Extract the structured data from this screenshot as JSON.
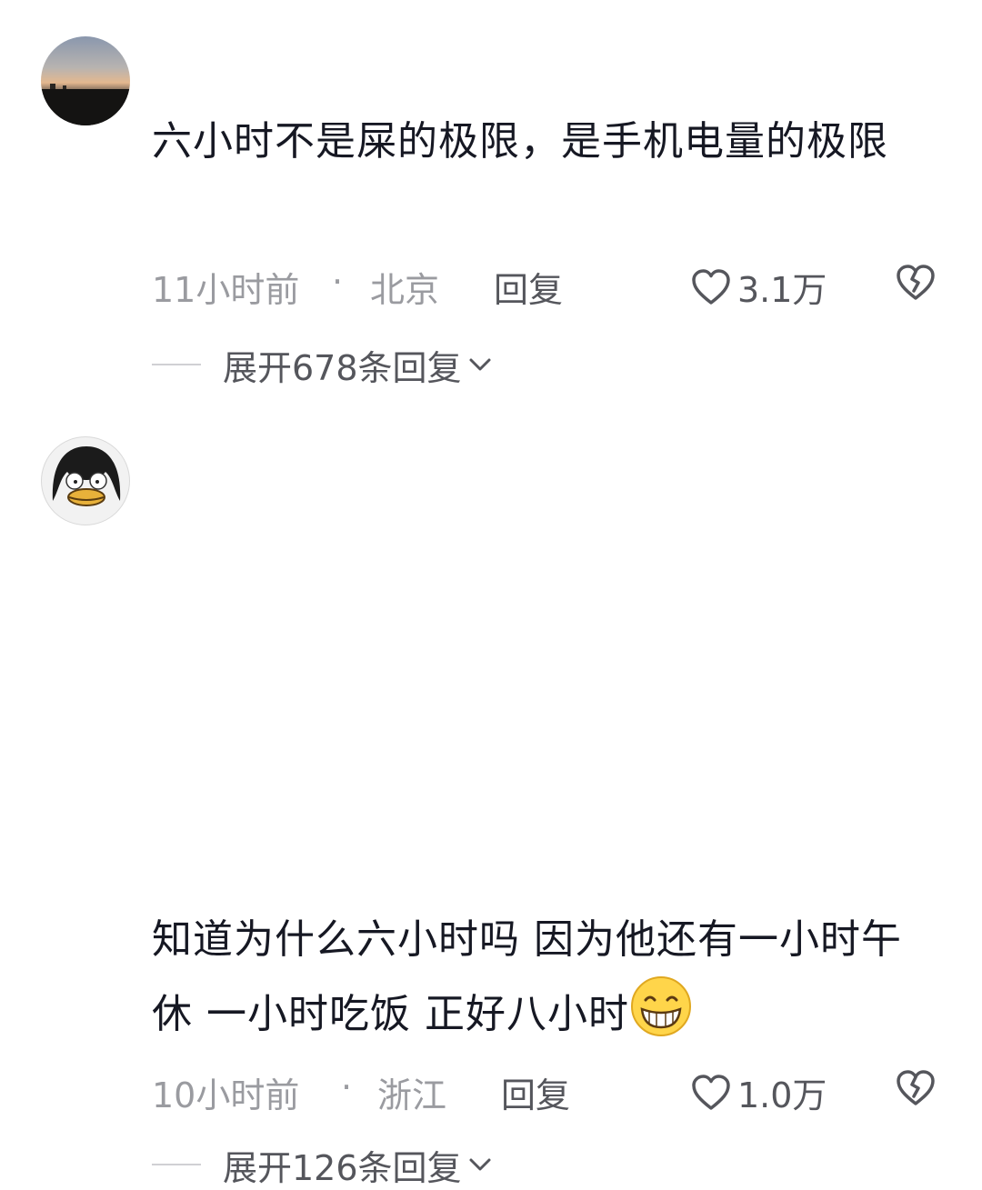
{
  "comments": [
    {
      "text": "六小时不是屎的极限，是手机电量的极限",
      "time": "11小时前",
      "separator": "·",
      "location": "北京",
      "reply_label": "回复",
      "likes": "3.1万",
      "expand_label": "展开678条回复"
    },
    {
      "text": "知道为什么六小时吗 因为他还有一小时午休 一小时吃饭 正好八小时",
      "emoji": "grinning-face-emoji",
      "time": "10小时前",
      "separator": "·",
      "location": "浙江",
      "reply_label": "回复",
      "likes": "1.0万",
      "expand_label": "展开126条回复"
    }
  ],
  "icons": {
    "like": "heart-outline-icon",
    "dislike": "broken-heart-icon",
    "expand": "chevron-down-icon"
  },
  "colors": {
    "text": "#161823",
    "meta": "#9a9ba0",
    "secondary": "#55565c"
  }
}
